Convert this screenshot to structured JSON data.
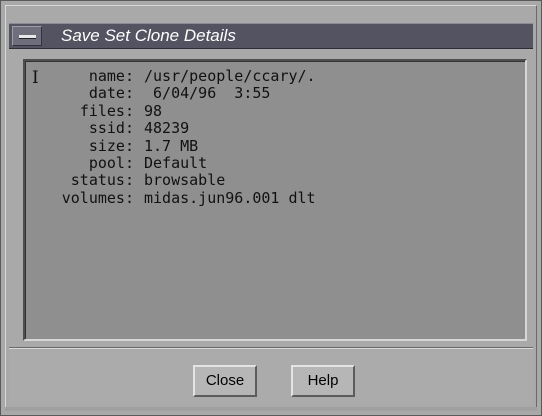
{
  "window": {
    "title": "Save Set Clone Details"
  },
  "details": {
    "cursor_glyph": "I",
    "rows": [
      {
        "label": "name:",
        "value": "/usr/people/ccary/."
      },
      {
        "label": "date:",
        "value": " 6/04/96  3:55"
      },
      {
        "label": "files:",
        "value": "98"
      },
      {
        "label": "ssid:",
        "value": "48239"
      },
      {
        "label": "size:",
        "value": "1.7 MB"
      },
      {
        "label": "pool:",
        "value": "Default"
      },
      {
        "label": "status:",
        "value": "browsable"
      },
      {
        "label": "volumes:",
        "value": "midas.jun96.001 dlt"
      }
    ]
  },
  "buttons": {
    "close_label": "Close",
    "help_label": "Help"
  },
  "icons": {
    "window_menu": "window-menu-icon",
    "text_cursor": "text-cursor-icon"
  },
  "colors": {
    "titlebar": "#535361",
    "panel": "#8f8f8f",
    "window": "#a9a9a9"
  }
}
